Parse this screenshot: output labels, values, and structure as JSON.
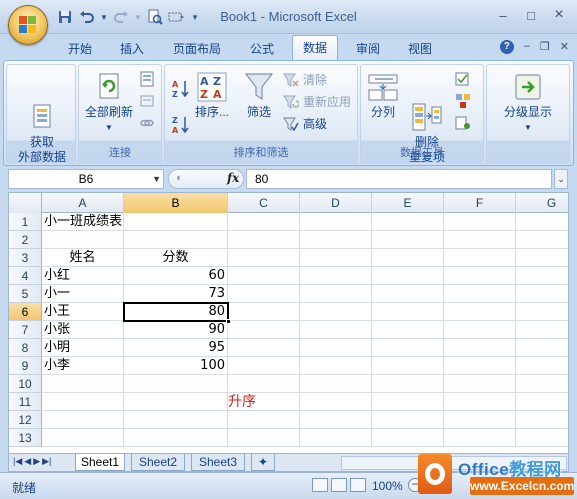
{
  "window": {
    "title": "Book1 - Microsoft Excel",
    "minimize": "–",
    "maximize": "□",
    "close": "×"
  },
  "quick_access": {
    "save_icon": "save-icon",
    "undo_icon": "undo-icon",
    "redo_icon": "redo-icon",
    "print_preview_icon": "print-preview-icon",
    "more_icon": "customize-icon"
  },
  "tabs": [
    {
      "label": "开始"
    },
    {
      "label": "插入"
    },
    {
      "label": "页面布局"
    },
    {
      "label": "公式"
    },
    {
      "label": "数据",
      "active": true
    },
    {
      "label": "审阅"
    },
    {
      "label": "视图"
    }
  ],
  "ribbon": {
    "groups": {
      "external": {
        "label": "",
        "button": "获取\n外部数据"
      },
      "connections": {
        "label": "连接",
        "refresh_all": "全部刷新"
      },
      "sort_filter": {
        "label": "排序和筛选",
        "sort": "排序...",
        "filter": "筛选",
        "clear": "清除",
        "reapply": "重新应用",
        "advanced": "高级"
      },
      "data_tools": {
        "label": "数据工具",
        "text_to_columns": "分列",
        "remove_duplicates": "删除\n重复项"
      },
      "outline": {
        "label": "",
        "button": "分级显示"
      }
    }
  },
  "formula_bar": {
    "name_box": "B6",
    "fx": "fx",
    "value": "80"
  },
  "columns": [
    "A",
    "B",
    "C",
    "D",
    "E",
    "F",
    "G"
  ],
  "selected_column": "B",
  "selected_row": "6",
  "rows": [
    {
      "n": "1",
      "a": "小一班成绩表",
      "b": ""
    },
    {
      "n": "2",
      "a": "",
      "b": ""
    },
    {
      "n": "3",
      "a": "姓名",
      "b": "分数"
    },
    {
      "n": "4",
      "a": "小红",
      "b": "60"
    },
    {
      "n": "5",
      "a": "小一",
      "b": "73"
    },
    {
      "n": "6",
      "a": "小王",
      "b": "80"
    },
    {
      "n": "7",
      "a": "小张",
      "b": "90"
    },
    {
      "n": "8",
      "a": "小明",
      "b": "95"
    },
    {
      "n": "9",
      "a": "小李",
      "b": "100"
    },
    {
      "n": "10",
      "a": "",
      "b": ""
    },
    {
      "n": "11",
      "a": "",
      "b": ""
    },
    {
      "n": "12",
      "a": "",
      "b": ""
    },
    {
      "n": "13",
      "a": "",
      "b": ""
    }
  ],
  "annotation": "升序",
  "sheets": [
    {
      "label": "Sheet1",
      "active": true
    },
    {
      "label": "Sheet2"
    },
    {
      "label": "Sheet3"
    }
  ],
  "status": {
    "text": "就绪",
    "zoom": "100%"
  },
  "watermark": {
    "line1_a": "Office",
    "line1_b": "教程网",
    "line2": "www.Excelcn.com"
  },
  "colors": {
    "accent": "#15428b",
    "selection_header": "#f4c66d",
    "annotation": "#d2231a",
    "watermark_orange": "#e86d0f"
  }
}
